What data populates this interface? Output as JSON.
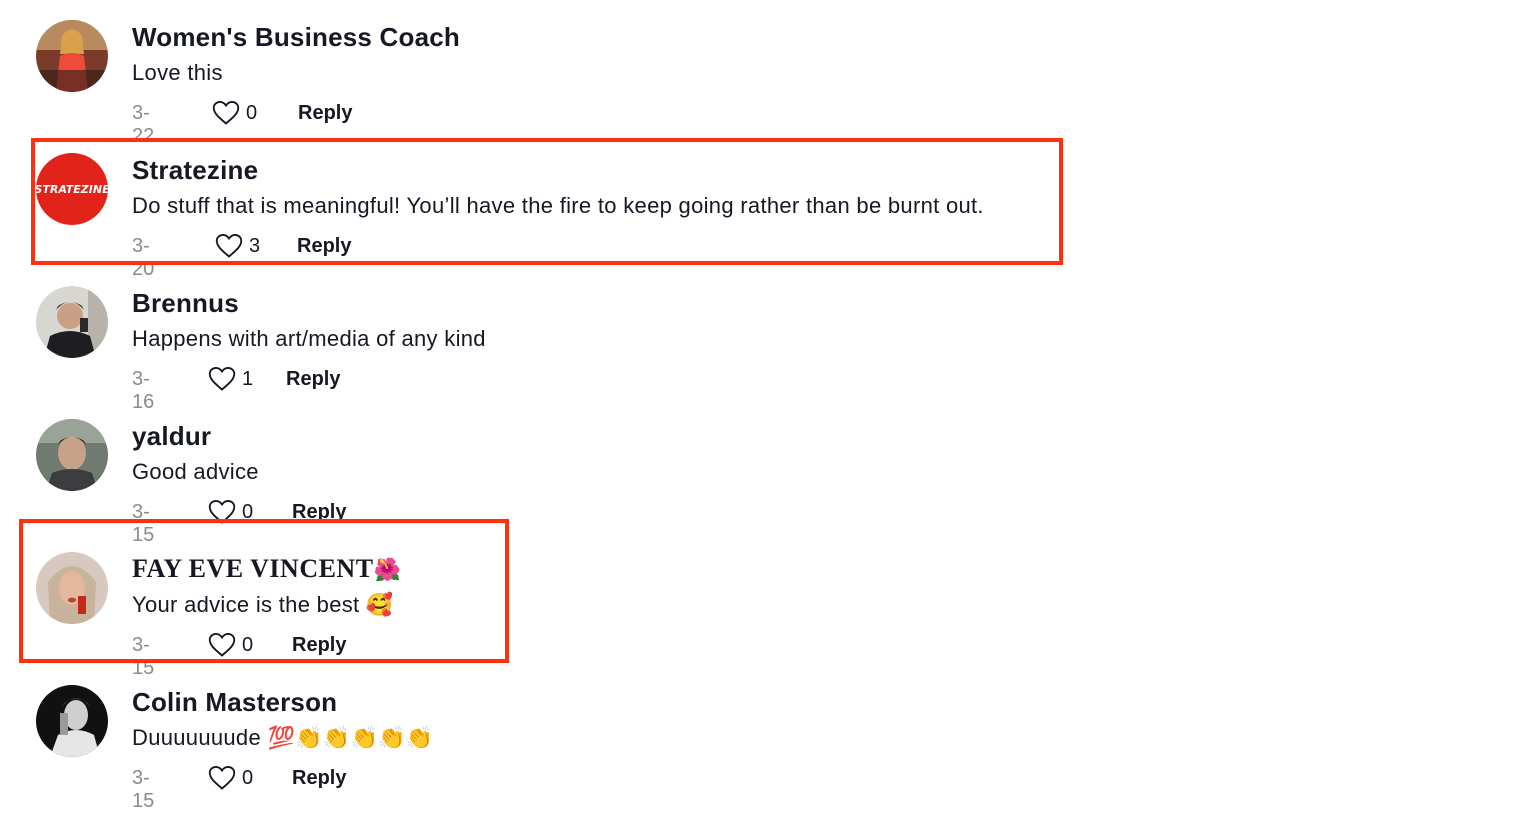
{
  "comments": [
    {
      "name": "Women's Business Coach",
      "text": "Love this",
      "date": "3-22",
      "likes": "0",
      "reply": "Reply"
    },
    {
      "name": "Stratezine",
      "text": "Do stuff that is meaningful! You’ll have the fire to keep going rather than be burnt out.",
      "date": "3-20",
      "likes": "3",
      "reply": "Reply",
      "avatar_text": "STRATEZINE"
    },
    {
      "name": "Brennus",
      "text": "Happens with art/media of any kind",
      "date": "3-16",
      "likes": "1",
      "reply": "Reply"
    },
    {
      "name": "yaldur",
      "text": "Good advice",
      "date": "3-15",
      "likes": "0",
      "reply": "Reply"
    },
    {
      "name": "FAY EVE VINCENT",
      "name_emoji": "🌺",
      "text": "Your advice is the best",
      "text_emoji": "🥰",
      "date": "3-15",
      "likes": "0",
      "reply": "Reply"
    },
    {
      "name": "Colin Masterson",
      "text": "Duuuuuuude",
      "text_emoji": "💯👏👏👏👏👏",
      "date": "3-15",
      "likes": "0",
      "reply": "Reply"
    }
  ],
  "colors": {
    "highlight": "#ff2f12",
    "date": "#8a8b91",
    "text": "#161823"
  },
  "icons": {
    "like": "heart-outline-icon"
  }
}
